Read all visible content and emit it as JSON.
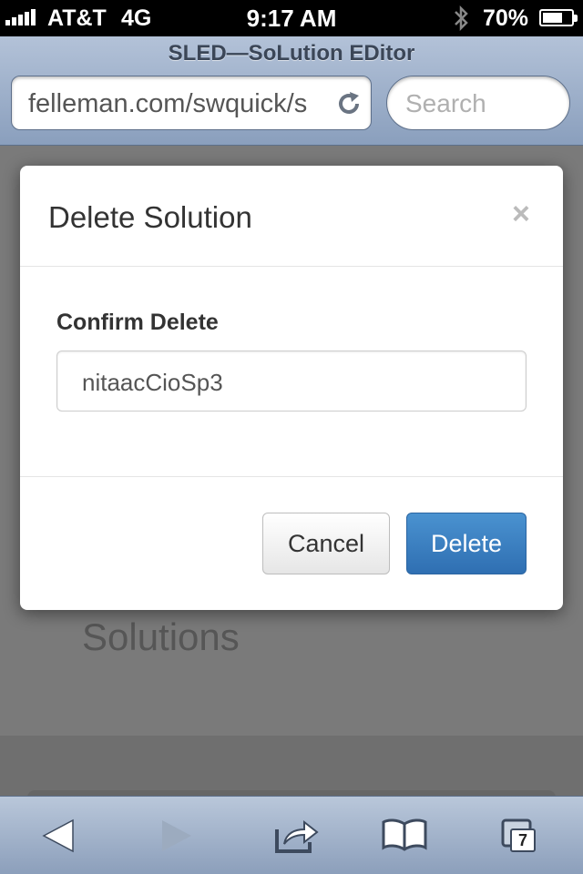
{
  "status_bar": {
    "carrier": "AT&T",
    "network": "4G",
    "time": "9:17 AM",
    "battery": "70%",
    "battery_level": 0.7
  },
  "browser": {
    "page_title": "SLED—SoLution EDitor",
    "url": "felleman.com/swquick/s",
    "search_placeholder": "Search",
    "tab_count": "7"
  },
  "page": {
    "heading": "Solutions"
  },
  "modal": {
    "title": "Delete Solution",
    "close_symbol": "×",
    "field_label": "Confirm Delete",
    "field_value": "nitaacCioSp3",
    "cancel_label": "Cancel",
    "delete_label": "Delete"
  },
  "colors": {
    "primary_button": "#337ab7",
    "browser_chrome": "#a3b4cc",
    "overlay": "#7a7a7a"
  },
  "icons": [
    "signal-icon",
    "bluetooth-icon",
    "battery-icon",
    "reload-icon",
    "back-icon",
    "forward-icon",
    "share-icon",
    "bookmarks-icon",
    "tabs-icon"
  ]
}
